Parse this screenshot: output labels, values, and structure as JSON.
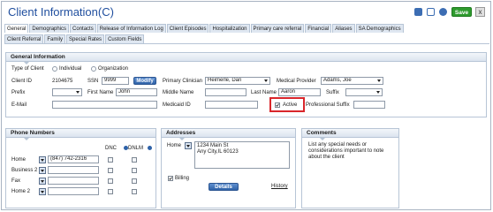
{
  "window": {
    "title": "Client Information(C)",
    "save_label": "Save",
    "close_label": "x"
  },
  "tabs_row1": [
    "General",
    "Demographics",
    "Contacts",
    "Release of Information Log",
    "Client Episodes",
    "Hospitalization",
    "Primary care referral",
    "Financial",
    "Aliases",
    "SA Demographics"
  ],
  "tabs_row2": [
    "Client Referral",
    "Family",
    "Special Rates",
    "Custom Fields"
  ],
  "general": {
    "heading": "General Information",
    "type_label": "Type of Client",
    "type_individual": "Individual",
    "type_organization": "Organization",
    "client_id_label": "Client ID",
    "client_id_value": "2104675",
    "ssn_label": "SSN",
    "ssn_value": "9999",
    "modify_label": "Modify",
    "primary_clinician_label": "Primary Clinician",
    "primary_clinician_value": "Heimerle, Dan",
    "medical_provider_label": "Medical Provider",
    "medical_provider_value": "Adams, Joe",
    "prefix_label": "Prefix",
    "first_name_label": "First Name",
    "first_name_value": "John",
    "middle_name_label": "Middle Name",
    "middle_name_value": "",
    "last_name_label": "Last Name",
    "last_name_value": "Aaron",
    "suffix_label": "Suffix",
    "email_label": "E-Mail",
    "medicaid_label": "Medicaid ID",
    "active_label": "Active",
    "professional_suffix_label": "Professional Suffix"
  },
  "phones": {
    "heading": "Phone Numbers",
    "dnc_label": "DNC",
    "dnlm_label": "DNLM",
    "rows": [
      {
        "label": "Home",
        "value": "(847) 742-2316"
      },
      {
        "label": "Business 2",
        "value": ""
      },
      {
        "label": "Fax",
        "value": ""
      },
      {
        "label": "Home 2",
        "value": ""
      }
    ]
  },
  "addresses": {
    "heading": "Addresses",
    "type_label": "Home",
    "line1": "1234 Main St",
    "line2": "Any City,IL 60123",
    "billing_label": "Billing",
    "details_label": "Details",
    "history_label": "History"
  },
  "comments": {
    "heading": "Comments",
    "placeholder": "List any special needs or considerations important to note about the client"
  },
  "colors": {
    "accent": "#1f4e9e",
    "save": "#2e9b2e",
    "highlight": "#d9262b",
    "tab_bg": "#dfe7f1"
  }
}
